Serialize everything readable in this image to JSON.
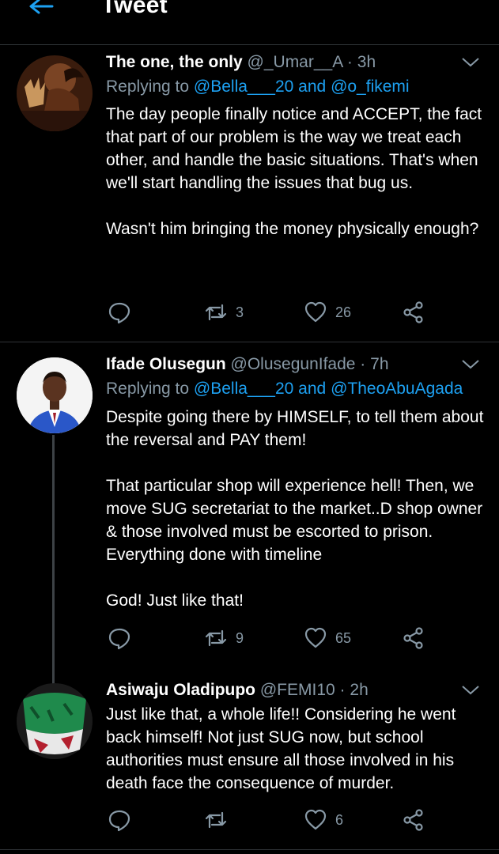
{
  "header": {
    "title": "Tweet",
    "back_icon": "arrow-left-icon"
  },
  "tweets": [
    {
      "name": "The one, the only",
      "handle": "@_Umar__A",
      "dot": "·",
      "time": "3h",
      "reply_prefix": "Replying to",
      "reply_mention1": "@Bella___20",
      "reply_and": "and",
      "reply_mention2": "@o_fikemi",
      "paragraphs": [
        "The day people finally notice and ACCEPT, the fact that part of our problem is the way we treat each other, and handle the basic situations. That's when we'll start handling the issues that bug us.",
        "Wasn't him bringing the money physically enough?"
      ],
      "retweets": "3",
      "likes": "26"
    },
    {
      "name": "Ifade Olusegun",
      "handle": "@OlusegunIfade",
      "dot": "·",
      "time": "7h",
      "reply_prefix": "Replying to",
      "reply_mention1": "@Bella___20",
      "reply_and": "and",
      "reply_mention2": "@TheoAbuAgada",
      "paragraphs": [
        "Despite going there by HIMSELF, to tell them about the reversal and PAY them!",
        "That particular shop will experience hell! Then, we move SUG secretariat to the market..D shop owner & those involved must be escorted to prison. Everything done with timeline",
        "God! Just like that!"
      ],
      "retweets": "9",
      "likes": "65"
    },
    {
      "name": "Asiwaju Oladipupo",
      "handle": "@FEMI10",
      "dot": "·",
      "time": "2h",
      "paragraphs": [
        "Just like that, a whole life!! Considering he went back himself! Not just SUG now, but school authorities must ensure all those involved in his death face the consequence of murder."
      ],
      "retweets": "",
      "likes": "6"
    }
  ],
  "icons": {
    "reply": "reply-icon",
    "retweet": "retweet-icon",
    "like": "heart-icon",
    "share": "share-icon",
    "more": "chevron-down-icon"
  },
  "colors": {
    "background": "#000000",
    "text": "#ffffff",
    "secondary": "#8899a6",
    "link": "#1da1f2",
    "divider": "#2f3336"
  }
}
